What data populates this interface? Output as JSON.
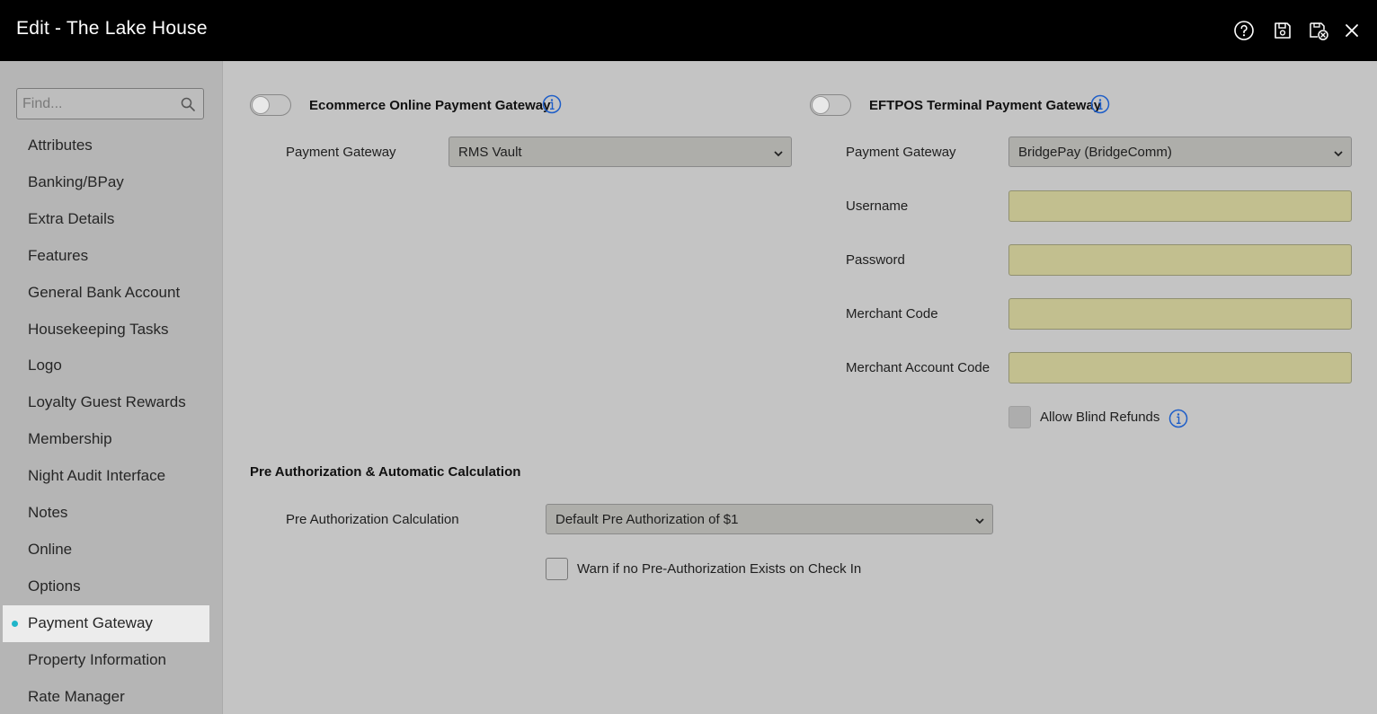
{
  "window": {
    "title": "Edit - The Lake House",
    "actions": [
      "help-icon",
      "save-icon",
      "save-close-icon",
      "close-icon"
    ]
  },
  "sidebar": {
    "search_placeholder": "Find...",
    "items": [
      {
        "label": "Attributes"
      },
      {
        "label": "Banking/BPay"
      },
      {
        "label": "Extra Details"
      },
      {
        "label": "Features"
      },
      {
        "label": "General Bank Account"
      },
      {
        "label": "Housekeeping Tasks"
      },
      {
        "label": "Logo"
      },
      {
        "label": "Loyalty Guest Rewards"
      },
      {
        "label": "Membership"
      },
      {
        "label": "Night Audit Interface"
      },
      {
        "label": "Notes"
      },
      {
        "label": "Online"
      },
      {
        "label": "Options"
      },
      {
        "label": "Payment Gateway",
        "active": true
      },
      {
        "label": "Property Information"
      },
      {
        "label": "Rate Manager"
      }
    ]
  },
  "ecommerce": {
    "title": "Ecommerce Online Payment Gateway",
    "enabled": false,
    "gateway_label": "Payment Gateway",
    "gateway_value": "RMS Vault"
  },
  "eftpos": {
    "title": "EFTPOS Terminal Payment Gateway",
    "enabled": false,
    "gateway_label": "Payment Gateway",
    "gateway_value": "BridgePay (BridgeComm)",
    "username_label": "Username",
    "username_value": "",
    "password_label": "Password",
    "password_value": "",
    "merchant_code_label": "Merchant Code",
    "merchant_code_value": "",
    "merchant_account_code_label": "Merchant Account Code",
    "merchant_account_code_value": "",
    "allow_blind_refunds_label": "Allow Blind Refunds",
    "allow_blind_refunds_checked": false
  },
  "preauth": {
    "title": "Pre Authorization & Automatic Calculation",
    "calc_label": "Pre Authorization Calculation",
    "calc_value": "Default Pre Authorization of $1",
    "warn_label": "Warn if no Pre-Authorization Exists on Check In",
    "warn_checked": false
  },
  "colors": {
    "accent": "#1fb5c9",
    "info": "#1e5ec8",
    "titlebar": "#000000"
  }
}
